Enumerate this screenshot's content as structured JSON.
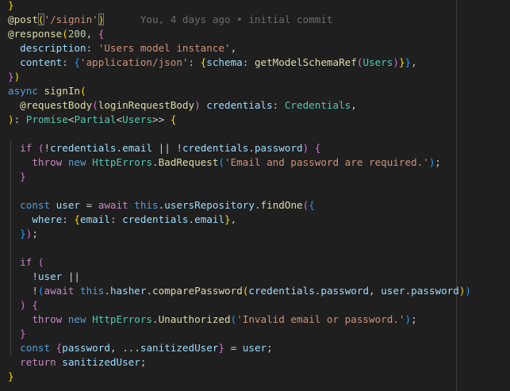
{
  "editor": {
    "colors": {
      "background": "#1f1f1f",
      "default": "#cccccc",
      "decorator": "#dcdcaa",
      "function": "#dcdcaa",
      "keyword": "#569cd6",
      "control": "#c586c0",
      "string": "#ce9178",
      "number": "#b5cea8",
      "property": "#9cdcfe",
      "type": "#4ec9b0",
      "bracket1": "#ffd700",
      "bracket2": "#da70d6",
      "bracket3": "#179fff",
      "blame": "#6b6b6b"
    },
    "lines": [
      {
        "tokens": [
          {
            "t": "}",
            "c": "bracket1"
          }
        ]
      },
      {
        "tokens": [
          {
            "t": "@post",
            "c": "decorator"
          },
          {
            "t": "(",
            "c": "bracket1",
            "hl": true
          },
          {
            "t": "'/signin'",
            "c": "string"
          },
          {
            "t": ")",
            "c": "bracket1",
            "hl": true
          },
          {
            "t": "      You, 4 days ago • initial commit",
            "c": "blame"
          }
        ]
      },
      {
        "tokens": [
          {
            "t": "@response",
            "c": "decorator"
          },
          {
            "t": "(",
            "c": "bracket1"
          },
          {
            "t": "200",
            "c": "number"
          },
          {
            "t": ", ",
            "c": "default"
          },
          {
            "t": "{",
            "c": "bracket2"
          }
        ]
      },
      {
        "tokens": [
          {
            "t": "  description",
            "c": "property"
          },
          {
            "t": ": ",
            "c": "default"
          },
          {
            "t": "'Users model instance'",
            "c": "string"
          },
          {
            "t": ",",
            "c": "default"
          }
        ]
      },
      {
        "tokens": [
          {
            "t": "  content",
            "c": "property"
          },
          {
            "t": ": ",
            "c": "default"
          },
          {
            "t": "{",
            "c": "bracket3"
          },
          {
            "t": "'application/json'",
            "c": "string"
          },
          {
            "t": ": ",
            "c": "default"
          },
          {
            "t": "{",
            "c": "bracket1"
          },
          {
            "t": "schema",
            "c": "property"
          },
          {
            "t": ": ",
            "c": "default"
          },
          {
            "t": "getModelSchemaRef",
            "c": "function"
          },
          {
            "t": "(",
            "c": "bracket2"
          },
          {
            "t": "Users",
            "c": "type"
          },
          {
            "t": ")",
            "c": "bracket2"
          },
          {
            "t": "}",
            "c": "bracket1"
          },
          {
            "t": "}",
            "c": "bracket3"
          },
          {
            "t": ",",
            "c": "default"
          }
        ]
      },
      {
        "tokens": [
          {
            "t": "}",
            "c": "bracket2"
          },
          {
            "t": ")",
            "c": "bracket1"
          }
        ]
      },
      {
        "tokens": [
          {
            "t": "async ",
            "c": "keyword"
          },
          {
            "t": "signIn",
            "c": "function"
          },
          {
            "t": "(",
            "c": "bracket1"
          }
        ]
      },
      {
        "tokens": [
          {
            "t": "  @requestBody",
            "c": "decorator"
          },
          {
            "t": "(",
            "c": "bracket2"
          },
          {
            "t": "loginRequestBody",
            "c": "function"
          },
          {
            "t": ")",
            "c": "bracket2"
          },
          {
            "t": " credentials",
            "c": "property"
          },
          {
            "t": ": ",
            "c": "default"
          },
          {
            "t": "Credentials",
            "c": "type"
          },
          {
            "t": ",",
            "c": "default"
          }
        ]
      },
      {
        "tokens": [
          {
            "t": ")",
            "c": "bracket1"
          },
          {
            "t": ": ",
            "c": "default"
          },
          {
            "t": "Promise",
            "c": "type"
          },
          {
            "t": "<",
            "c": "default"
          },
          {
            "t": "Partial",
            "c": "type"
          },
          {
            "t": "<",
            "c": "default"
          },
          {
            "t": "Users",
            "c": "type"
          },
          {
            "t": ">> ",
            "c": "default"
          },
          {
            "t": "{",
            "c": "bracket1"
          }
        ]
      },
      {
        "tokens": []
      },
      {
        "tokens": [
          {
            "t": "  if ",
            "c": "control"
          },
          {
            "t": "(",
            "c": "bracket2"
          },
          {
            "t": "!",
            "c": "default"
          },
          {
            "t": "credentials",
            "c": "property"
          },
          {
            "t": ".",
            "c": "default"
          },
          {
            "t": "email",
            "c": "property"
          },
          {
            "t": " || !",
            "c": "default"
          },
          {
            "t": "credentials",
            "c": "property"
          },
          {
            "t": ".",
            "c": "default"
          },
          {
            "t": "password",
            "c": "property"
          },
          {
            "t": ") ",
            "c": "bracket2"
          },
          {
            "t": "{",
            "c": "bracket2"
          }
        ]
      },
      {
        "tokens": [
          {
            "t": "    throw ",
            "c": "control"
          },
          {
            "t": "new ",
            "c": "keyword"
          },
          {
            "t": "HttpErrors",
            "c": "type"
          },
          {
            "t": ".",
            "c": "default"
          },
          {
            "t": "BadRequest",
            "c": "function"
          },
          {
            "t": "(",
            "c": "bracket3"
          },
          {
            "t": "'Email and password are required.'",
            "c": "string"
          },
          {
            "t": ")",
            "c": "bracket3"
          },
          {
            "t": ";",
            "c": "default"
          }
        ]
      },
      {
        "tokens": [
          {
            "t": "  }",
            "c": "bracket2"
          }
        ]
      },
      {
        "tokens": []
      },
      {
        "tokens": [
          {
            "t": "  const ",
            "c": "keyword"
          },
          {
            "t": "user",
            "c": "property"
          },
          {
            "t": " = ",
            "c": "default"
          },
          {
            "t": "await ",
            "c": "control"
          },
          {
            "t": "this",
            "c": "keyword"
          },
          {
            "t": ".",
            "c": "default"
          },
          {
            "t": "usersRepository",
            "c": "property"
          },
          {
            "t": ".",
            "c": "default"
          },
          {
            "t": "findOne",
            "c": "function"
          },
          {
            "t": "(",
            "c": "bracket2"
          },
          {
            "t": "{",
            "c": "bracket3"
          }
        ]
      },
      {
        "tokens": [
          {
            "t": "    where",
            "c": "property"
          },
          {
            "t": ": ",
            "c": "default"
          },
          {
            "t": "{",
            "c": "bracket1"
          },
          {
            "t": "email",
            "c": "property"
          },
          {
            "t": ": ",
            "c": "default"
          },
          {
            "t": "credentials",
            "c": "property"
          },
          {
            "t": ".",
            "c": "default"
          },
          {
            "t": "email",
            "c": "property"
          },
          {
            "t": "}",
            "c": "bracket1"
          },
          {
            "t": ",",
            "c": "default"
          }
        ]
      },
      {
        "tokens": [
          {
            "t": "  }",
            "c": "bracket3"
          },
          {
            "t": ")",
            "c": "bracket2"
          },
          {
            "t": ";",
            "c": "default"
          }
        ]
      },
      {
        "tokens": []
      },
      {
        "tokens": [
          {
            "t": "  if ",
            "c": "control"
          },
          {
            "t": "(",
            "c": "bracket2"
          }
        ]
      },
      {
        "tokens": [
          {
            "t": "    !",
            "c": "default"
          },
          {
            "t": "user",
            "c": "property"
          },
          {
            "t": " ||",
            "c": "default"
          }
        ]
      },
      {
        "tokens": [
          {
            "t": "    !",
            "c": "default"
          },
          {
            "t": "(",
            "c": "bracket3"
          },
          {
            "t": "await ",
            "c": "control"
          },
          {
            "t": "this",
            "c": "keyword"
          },
          {
            "t": ".",
            "c": "default"
          },
          {
            "t": "hasher",
            "c": "property"
          },
          {
            "t": ".",
            "c": "default"
          },
          {
            "t": "comparePassword",
            "c": "function"
          },
          {
            "t": "(",
            "c": "bracket1"
          },
          {
            "t": "credentials",
            "c": "property"
          },
          {
            "t": ".",
            "c": "default"
          },
          {
            "t": "password",
            "c": "property"
          },
          {
            "t": ", ",
            "c": "default"
          },
          {
            "t": "user",
            "c": "property"
          },
          {
            "t": ".",
            "c": "default"
          },
          {
            "t": "password",
            "c": "property"
          },
          {
            "t": ")",
            "c": "bracket1"
          },
          {
            "t": ")",
            "c": "bracket3"
          }
        ]
      },
      {
        "tokens": [
          {
            "t": "  ) ",
            "c": "bracket2"
          },
          {
            "t": "{",
            "c": "bracket2"
          }
        ]
      },
      {
        "tokens": [
          {
            "t": "    throw ",
            "c": "control"
          },
          {
            "t": "new ",
            "c": "keyword"
          },
          {
            "t": "HttpErrors",
            "c": "type"
          },
          {
            "t": ".",
            "c": "default"
          },
          {
            "t": "Unauthorized",
            "c": "function"
          },
          {
            "t": "(",
            "c": "bracket3"
          },
          {
            "t": "'Invalid email or password.'",
            "c": "string"
          },
          {
            "t": ")",
            "c": "bracket3"
          },
          {
            "t": ";",
            "c": "default"
          }
        ]
      },
      {
        "tokens": [
          {
            "t": "  }",
            "c": "bracket2"
          }
        ]
      },
      {
        "tokens": [
          {
            "t": "  const ",
            "c": "keyword"
          },
          {
            "t": "{",
            "c": "bracket2"
          },
          {
            "t": "password",
            "c": "property"
          },
          {
            "t": ", ...",
            "c": "default"
          },
          {
            "t": "sanitizedUser",
            "c": "property"
          },
          {
            "t": "}",
            "c": "bracket2"
          },
          {
            "t": " = ",
            "c": "default"
          },
          {
            "t": "user",
            "c": "property"
          },
          {
            "t": ";",
            "c": "default"
          }
        ]
      },
      {
        "tokens": [
          {
            "t": "  return ",
            "c": "control"
          },
          {
            "t": "sanitizedUser",
            "c": "property"
          },
          {
            "t": ";",
            "c": "default"
          }
        ]
      },
      {
        "tokens": [
          {
            "t": "}",
            "c": "bracket1"
          }
        ]
      }
    ]
  }
}
